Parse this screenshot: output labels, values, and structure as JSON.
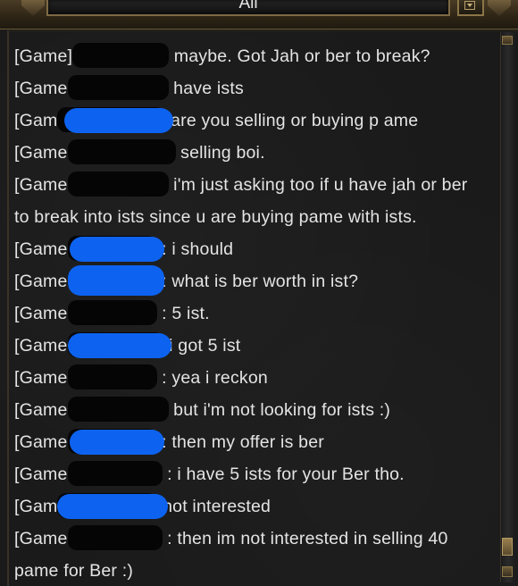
{
  "header": {
    "tab_label": "All"
  },
  "chat": {
    "messages": [
      {
        "prefix": "[Game]",
        "text": "maybe. Got Jah or ber to break?"
      },
      {
        "prefix": "[Game",
        "text": "have ists"
      },
      {
        "prefix": "[Gam",
        "text": "are you selling or buying p ame"
      },
      {
        "prefix": "[Game",
        "text": "selling boi."
      },
      {
        "prefix": "[Game",
        "text": "i'm just asking too if u have jah or ber",
        "continuation": "to break into ists since u are buying pame with ists."
      },
      {
        "prefix": "[Game",
        "text": ": i should"
      },
      {
        "prefix": "[Game",
        "text": ": what is ber worth in ist?"
      },
      {
        "prefix": "[Game",
        "text": ": 5 ist."
      },
      {
        "prefix": "[Game",
        "text": "i got 5 ist"
      },
      {
        "prefix": "[Game",
        "text": ": yea i reckon"
      },
      {
        "prefix": "[Game",
        "text": "but i'm not looking for ists :)"
      },
      {
        "prefix": "[Game",
        "text": ": then my offer is ber"
      },
      {
        "prefix": "[Game",
        "text": ": i have 5 ists for your Ber tho."
      },
      {
        "prefix": "[Gam",
        "text": "not interested"
      },
      {
        "prefix": "[Game",
        "text": ": then im not interested in selling 40",
        "continuation": "pame for Ber :)"
      }
    ]
  },
  "colors": {
    "redaction_black": "#050505",
    "redaction_blue": "#0d63f0",
    "chat_text": "#e4e4e4",
    "frame_gold": "#7d6a45"
  },
  "icons": {
    "dropdown": "chevron-down-icon"
  }
}
